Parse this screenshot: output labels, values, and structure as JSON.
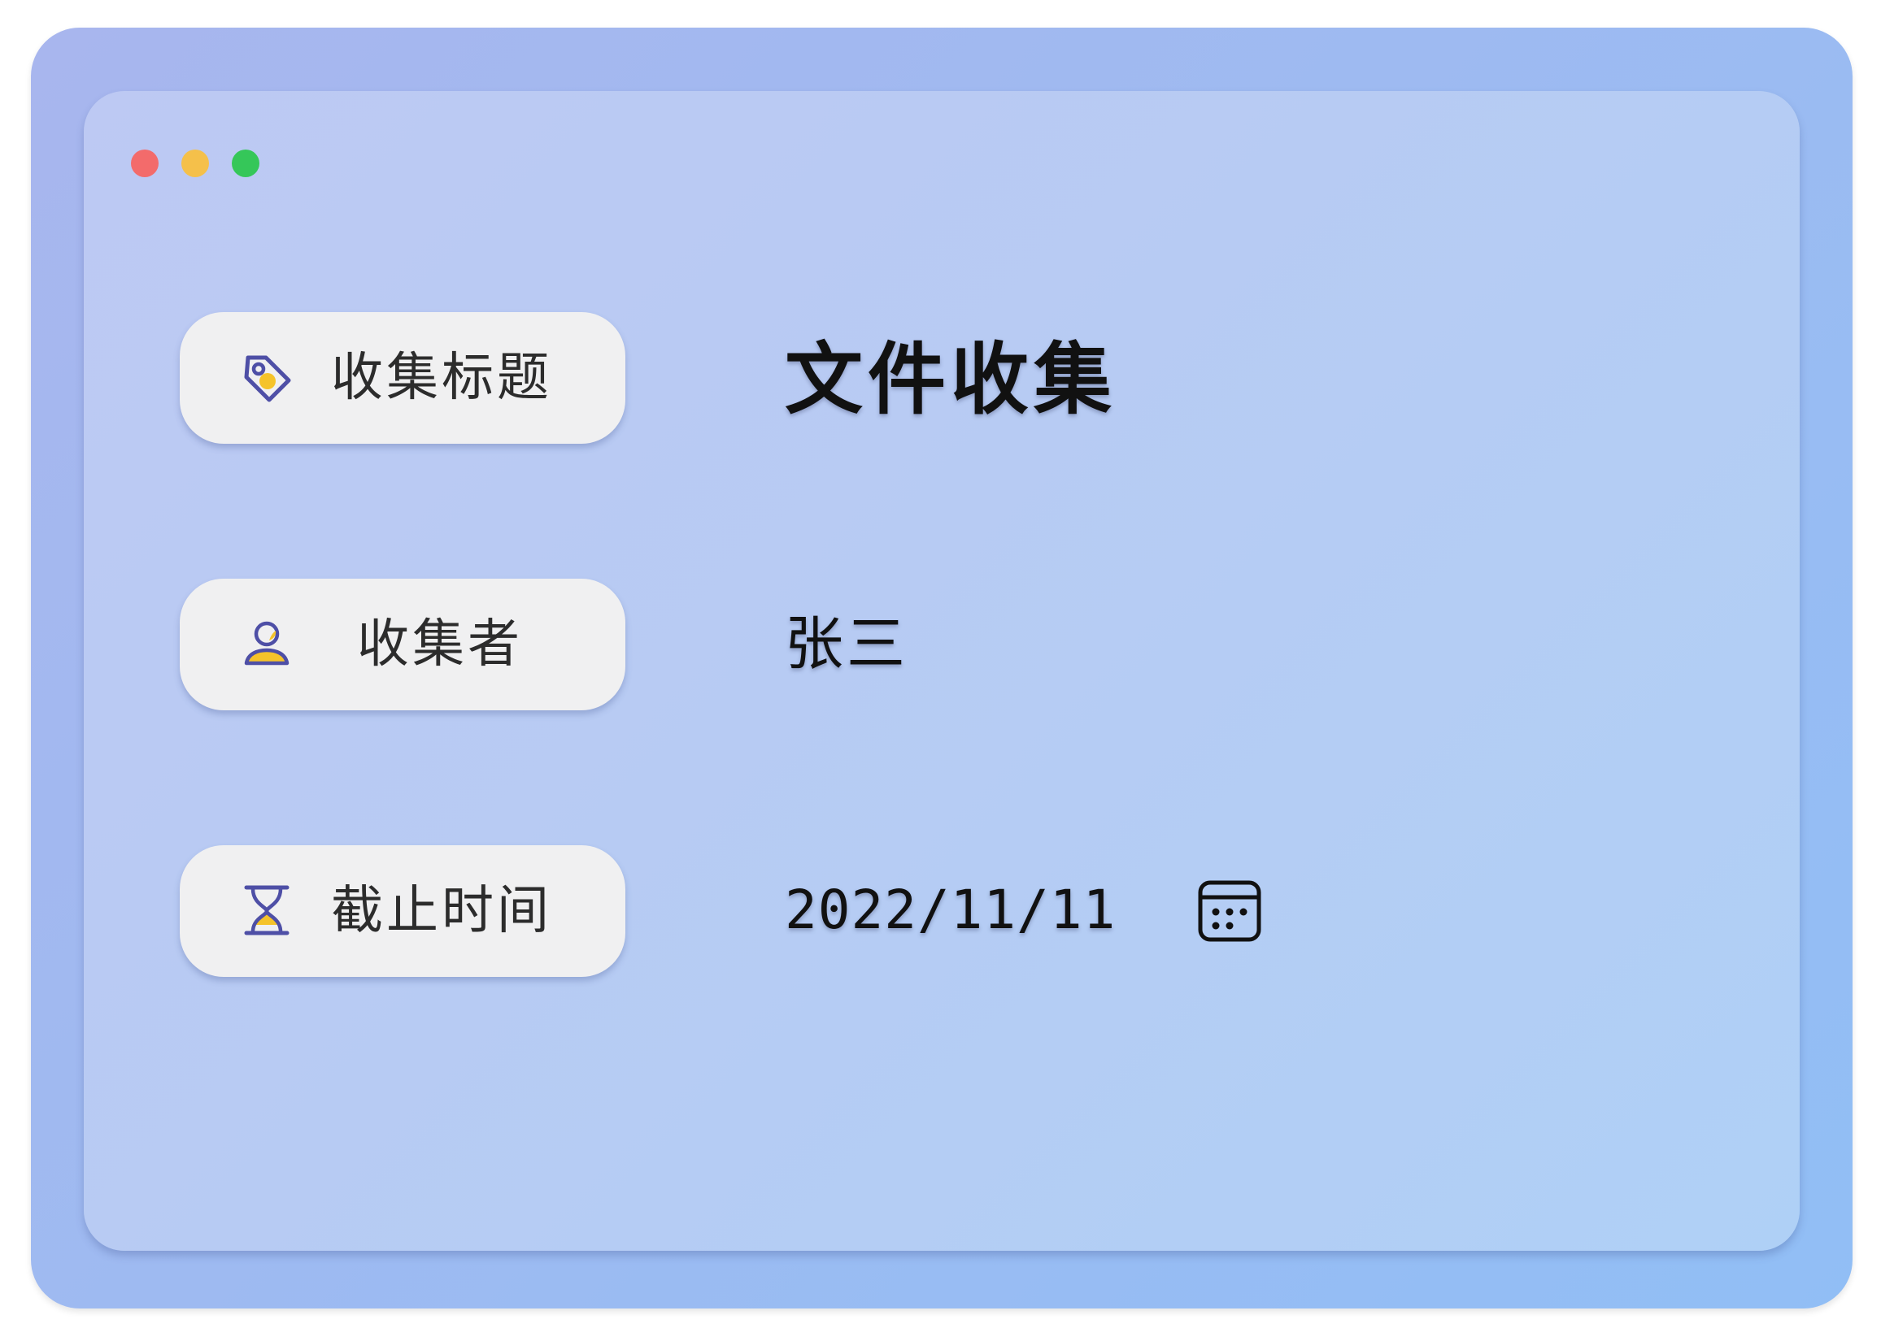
{
  "window_controls": {
    "close_color": "#f36b6b",
    "minimize_color": "#f5c04a",
    "maximize_color": "#35c759"
  },
  "fields": {
    "title": {
      "label": "收集标题",
      "icon": "tag-icon",
      "value": "文件收集"
    },
    "collector": {
      "label": "收集者",
      "icon": "user-icon",
      "value": "张三"
    },
    "deadline": {
      "label": "截止时间",
      "icon": "hourglass-icon",
      "value": "2022/11/11",
      "picker_icon": "calendar-icon"
    }
  },
  "colors": {
    "icon_stroke": "#4e4fa6",
    "icon_accent": "#f5c32a",
    "pill_background": "#f0f0f1"
  }
}
